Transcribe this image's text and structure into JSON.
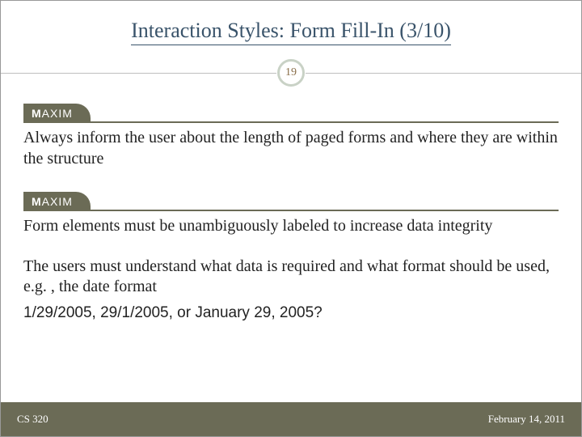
{
  "title": "Interaction Styles: Form Fill-In (3/10)",
  "slide_number": "19",
  "maxim_label": {
    "bold": "M",
    "rest": "AXIM"
  },
  "maxim1_text": "Always inform the user about the length of paged forms and where they are within the structure",
  "maxim2_text": "Form elements must be unambiguously labeled to increase data integrity",
  "note_text": "The users must understand what data is required and what format should be used, e.g. , the date format",
  "date_question": "1/29/2005, 29/1/2005, or January 29, 2005?",
  "footer": {
    "left": "CS 320",
    "right": "February 14, 2011"
  }
}
